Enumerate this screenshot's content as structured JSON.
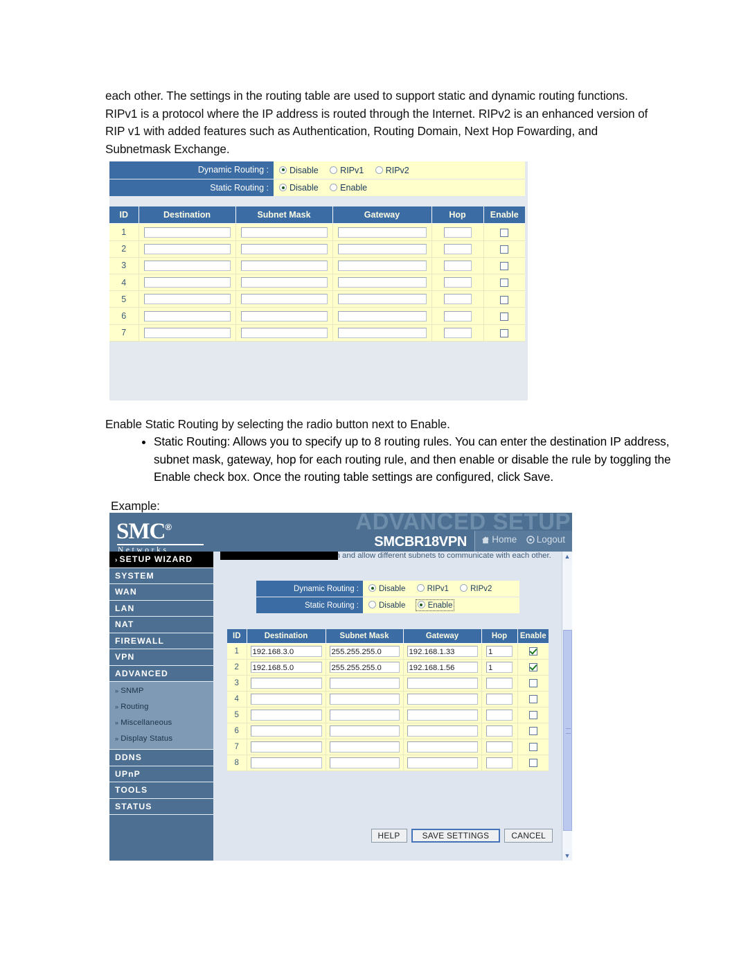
{
  "document": {
    "intro_paragraph": "each other. The settings in the routing table are used to support static and dynamic routing functions. RIPv1 is a protocol where the IP address is routed through the Internet. RIPv2 is an enhanced version of RIP v1 with added features such as Authentication, Routing Domain, Next Hop Fowarding, and Subnetmask Exchange.",
    "enable_paragraph": "Enable Static Routing by selecting the radio button next to Enable.",
    "bullets": [
      "Static Routing: Allows you to specify up to 8 routing rules. You can enter the destination IP address, subnet mask, gateway, hop for each routing rule, and then enable or disable the rule by toggling the Enable check box. Once the routing table settings are configured, click Save."
    ],
    "example_label": "Example:"
  },
  "colors": {
    "header_blue": "#3c6ca4",
    "banner_blue": "#4d6f91",
    "row_yellow": "#ffffcc",
    "content_bg": "#dfe5ee",
    "sidebar_sub": "#7e9ab5",
    "check_green": "#1f7a1f"
  },
  "screenshot1": {
    "dynamic_routing": {
      "label": "Dynamic Routing :",
      "options": [
        "Disable",
        "RIPv1",
        "RIPv2"
      ],
      "selected": "Disable"
    },
    "static_routing": {
      "label": "Static Routing :",
      "options": [
        "Disable",
        "Enable"
      ],
      "selected": "Disable",
      "focused": null
    },
    "table": {
      "columns": [
        "ID",
        "Destination",
        "Subnet Mask",
        "Gateway",
        "Hop",
        "Enable"
      ],
      "rows": [
        {
          "id": "1",
          "destination": "",
          "subnet_mask": "",
          "gateway": "",
          "hop": "",
          "enabled": false
        },
        {
          "id": "2",
          "destination": "",
          "subnet_mask": "",
          "gateway": "",
          "hop": "",
          "enabled": false
        },
        {
          "id": "3",
          "destination": "",
          "subnet_mask": "",
          "gateway": "",
          "hop": "",
          "enabled": false
        },
        {
          "id": "4",
          "destination": "",
          "subnet_mask": "",
          "gateway": "",
          "hop": "",
          "enabled": false
        },
        {
          "id": "5",
          "destination": "",
          "subnet_mask": "",
          "gateway": "",
          "hop": "",
          "enabled": false
        },
        {
          "id": "6",
          "destination": "",
          "subnet_mask": "",
          "gateway": "",
          "hop": "",
          "enabled": false
        },
        {
          "id": "7",
          "destination": "",
          "subnet_mask": "",
          "gateway": "",
          "hop": "",
          "enabled": false
        }
      ]
    }
  },
  "screenshot2": {
    "banner": {
      "brand": "SMC",
      "brand_mark": "®",
      "brand_sub": "Networks",
      "ghost_title": "ADVANCED SETUP",
      "model": "SMCBR18VPN",
      "home_label": "Home",
      "logout_label": "Logout"
    },
    "sidebar": {
      "items": [
        {
          "label": "SETUP WIZARD",
          "style": "wizard",
          "chevron": "›"
        },
        {
          "label": "SYSTEM",
          "style": "main"
        },
        {
          "label": "WAN",
          "style": "main"
        },
        {
          "label": "LAN",
          "style": "main"
        },
        {
          "label": "NAT",
          "style": "main"
        },
        {
          "label": "FIREWALL",
          "style": "main"
        },
        {
          "label": "VPN",
          "style": "main"
        },
        {
          "label": "ADVANCED",
          "style": "main"
        }
      ],
      "sub_items": [
        {
          "label": "SNMP",
          "chevron": "»"
        },
        {
          "label": "Routing",
          "chevron": "»"
        },
        {
          "label": "Miscellaneous",
          "chevron": "»"
        },
        {
          "label": "Display Status",
          "chevron": "»"
        }
      ],
      "items_after": [
        {
          "label": "DDNS",
          "style": "main"
        },
        {
          "label": "UPnP",
          "style": "main"
        },
        {
          "label": "TOOLS",
          "style": "main"
        },
        {
          "label": "STATUS",
          "style": "main"
        }
      ]
    },
    "content_blurb": "packets to find proper routing path and allow different subnets to communicate with each other.",
    "dynamic_routing": {
      "label": "Dynamic Routing :",
      "options": [
        "Disable",
        "RIPv1",
        "RIPv2"
      ],
      "selected": "Disable"
    },
    "static_routing": {
      "label": "Static Routing :",
      "options": [
        "Disable",
        "Enable"
      ],
      "selected": "Enable",
      "focused": "Enable"
    },
    "table": {
      "columns": [
        "ID",
        "Destination",
        "Subnet Mask",
        "Gateway",
        "Hop",
        "Enable"
      ],
      "rows": [
        {
          "id": "1",
          "destination": "192.168.3.0",
          "subnet_mask": "255.255.255.0",
          "gateway": "192.168.1.33",
          "hop": "1",
          "enabled": true
        },
        {
          "id": "2",
          "destination": "192.168.5.0",
          "subnet_mask": "255.255.255.0",
          "gateway": "192.168.1.56",
          "hop": "1",
          "enabled": true
        },
        {
          "id": "3",
          "destination": "",
          "subnet_mask": "",
          "gateway": "",
          "hop": "",
          "enabled": false
        },
        {
          "id": "4",
          "destination": "",
          "subnet_mask": "",
          "gateway": "",
          "hop": "",
          "enabled": false
        },
        {
          "id": "5",
          "destination": "",
          "subnet_mask": "",
          "gateway": "",
          "hop": "",
          "enabled": false
        },
        {
          "id": "6",
          "destination": "",
          "subnet_mask": "",
          "gateway": "",
          "hop": "",
          "enabled": false
        },
        {
          "id": "7",
          "destination": "",
          "subnet_mask": "",
          "gateway": "",
          "hop": "",
          "enabled": false
        },
        {
          "id": "8",
          "destination": "",
          "subnet_mask": "",
          "gateway": "",
          "hop": "",
          "enabled": false
        }
      ]
    },
    "buttons": [
      {
        "label": "HELP",
        "primary": false
      },
      {
        "label": "SAVE SETTINGS",
        "primary": true
      },
      {
        "label": "CANCEL",
        "primary": false
      }
    ],
    "scrollbar": {
      "up_glyph": "▲",
      "down_glyph": "▼"
    }
  }
}
